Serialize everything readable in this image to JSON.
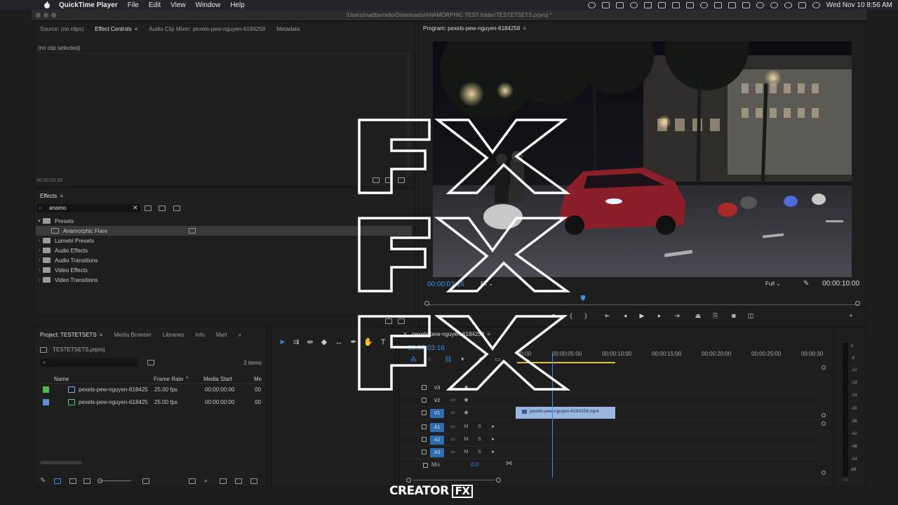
{
  "menubar": {
    "app_name": "QuickTime Player",
    "menus": [
      "File",
      "Edit",
      "View",
      "Window",
      "Help"
    ],
    "datetime": "Wed Nov 10  8:56 AM"
  },
  "window": {
    "title": "/Users/mattbarretto/Downloads/ANAMORPHIC TEST folder/TESTETSETS.prproj *"
  },
  "source_panel": {
    "tabs": [
      "Source: (no clips)",
      "Effect Controls",
      "Audio Clip Mixer: pexels-pew-nguyen-6184258",
      "Metadata"
    ],
    "active_tab": "Effect Controls",
    "empty_text": "(no clip selected)",
    "timecode": "00:00:03:16"
  },
  "effects_panel": {
    "title": "Effects",
    "search_value": "anamo",
    "tree": [
      {
        "label": "Presets",
        "expanded": true
      },
      {
        "label": "Anamorphic Flare",
        "child": true,
        "selected": true
      },
      {
        "label": "Lumetri Presets"
      },
      {
        "label": "Audio Effects"
      },
      {
        "label": "Audio Transitions"
      },
      {
        "label": "Video Effects"
      },
      {
        "label": "Video Transitions"
      }
    ]
  },
  "program_monitor": {
    "title": "Program: pexels-pew-nguyen-6184258",
    "timecode": "00:00:03:16",
    "fit": "Fit",
    "resolution": "Full",
    "duration": "00:00:10:00"
  },
  "project_panel": {
    "tabs": [
      "Project: TESTETSETS",
      "Media Browser",
      "Libraries",
      "Info",
      "Marl"
    ],
    "file": "TESTETSETS.prproj",
    "items_count": "2 items",
    "headers": [
      "Name",
      "Frame Rate",
      "Media Start",
      "Me"
    ],
    "rows": [
      {
        "name": "pexels-pew-nguyen-618425",
        "fps": "25.00 fps",
        "start": "00:00:00:00",
        "extra": "00",
        "color": "#4fb84f"
      },
      {
        "name": "pexels-pew-nguyen-618425",
        "fps": "25.00 fps",
        "start": "00:00:00:00",
        "extra": "00",
        "color": "#5b8fd6"
      }
    ]
  },
  "timeline": {
    "title": "pexels-pew-nguyen-6184258",
    "timecode": "00:00:03:16",
    "ruler": [
      "00:00",
      "00:00:05:00",
      "00:00:10:00",
      "00:00:15:00",
      "00:00:20:00",
      "00:00:25:00",
      "00:00:30"
    ],
    "video_tracks": [
      "V3",
      "V2",
      "V1"
    ],
    "audio_tracks": [
      "A1",
      "A2",
      "A3"
    ],
    "clip_name": "pexels-pew-nguyen-6184258.mp4",
    "mix_label": "Mix",
    "mix_value": "0.0"
  },
  "meter": {
    "db_labels": [
      "0",
      "-6",
      "-12",
      "-18",
      "-24",
      "-30",
      "-36",
      "-42",
      "-48",
      "-54",
      "dB"
    ]
  },
  "overlay": {
    "fx_text": "FX",
    "brand_left": "CREATOR",
    "brand_right": "FX"
  },
  "colors": {
    "accent_blue": "#3d8fe6",
    "clip_blue": "#9ab6df",
    "panel_bg": "#1e1e1e"
  }
}
